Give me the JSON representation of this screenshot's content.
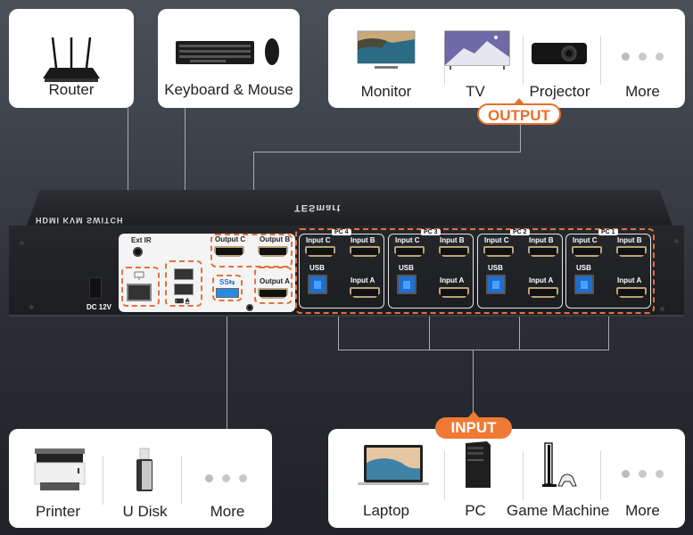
{
  "top_cards": {
    "router": {
      "label": "Router",
      "icon": "router-icon"
    },
    "keyboard_mouse": {
      "label": "Keyboard & Mouse",
      "icon": "keyboard-mouse-icon"
    }
  },
  "output_card": {
    "items": [
      {
        "label": "Monitor",
        "icon": "monitor-icon"
      },
      {
        "label": "TV",
        "icon": "tv-icon"
      },
      {
        "label": "Projector",
        "icon": "projector-icon"
      },
      {
        "label": "More",
        "icon": "more-dots-icon"
      }
    ],
    "badge": "OUTPUT"
  },
  "input_card": {
    "items": [
      {
        "label": "Laptop",
        "icon": "laptop-icon"
      },
      {
        "label": "PC",
        "icon": "pc-tower-icon"
      },
      {
        "label": "Game Machine",
        "icon": "game-console-icon"
      },
      {
        "label": "More",
        "icon": "more-dots-icon"
      }
    ],
    "badge": "INPUT"
  },
  "usb_card": {
    "items": [
      {
        "label": "Printer",
        "icon": "printer-icon"
      },
      {
        "label": "U Disk",
        "icon": "usb-drive-icon"
      },
      {
        "label": "More",
        "icon": "more-dots-icon"
      }
    ]
  },
  "device": {
    "power_label": "DC 12V",
    "ext_ir_label": "Ext IR",
    "usb3_label": "SS⇆",
    "outputs": [
      "Output C",
      "Output B",
      "Output A"
    ],
    "pc_panels": [
      {
        "tag": "PC 4",
        "input_c": "Input C",
        "input_b": "Input B",
        "usb": "USB",
        "input_a": "Input A"
      },
      {
        "tag": "PC 3",
        "input_c": "Input C",
        "input_b": "Input B",
        "usb": "USB",
        "input_a": "Input A"
      },
      {
        "tag": "PC 2",
        "input_c": "Input C",
        "input_b": "Input B",
        "usb": "USB",
        "input_a": "Input A"
      },
      {
        "tag": "PC 1",
        "input_c": "Input C",
        "input_b": "Input B",
        "usb": "USB",
        "input_a": "Input A"
      }
    ]
  },
  "colors": {
    "accent": "#f07a34",
    "card": "#ffffff",
    "dash": "#e8703a"
  }
}
